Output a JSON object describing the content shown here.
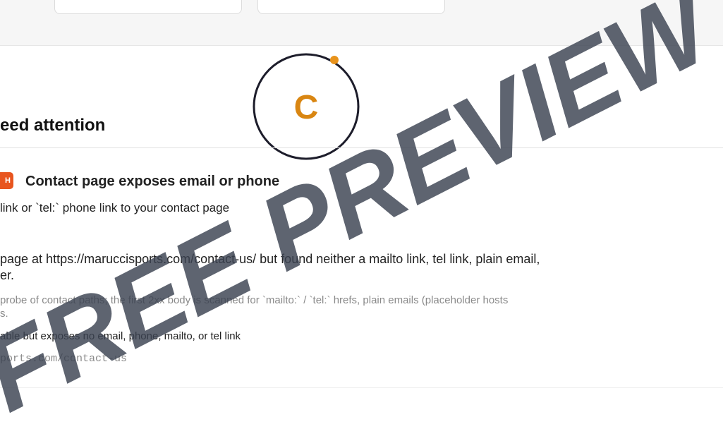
{
  "logo": {
    "letter": "C",
    "ring_color": "#1d1d2b",
    "letter_color": "#d98612",
    "dot_color": "#e8931c"
  },
  "section": {
    "title": "eed attention"
  },
  "finding": {
    "severity_badge": "H",
    "severity_color": "#e8551f",
    "title": "Contact page exposes email or phone",
    "summary": "link or `tel:` phone link to your contact page",
    "detail_line1": "page at https://maruccisports.com/contact-us/ but found neither a mailto link, tel link, plain email,",
    "detail_line2": "er.",
    "method_line1": "probe of contact paths; the first 2xx body is scanned for `mailto:` / `tel:` hrefs, plain emails (placeholder hosts",
    "method_line2": "s.",
    "evidence": "able but exposes no email, phone, mailto, or tel link",
    "evidence_url": "ports.com/contact-us"
  },
  "watermark": {
    "text": "FREE PREVIEW",
    "color": "#3a4250"
  }
}
